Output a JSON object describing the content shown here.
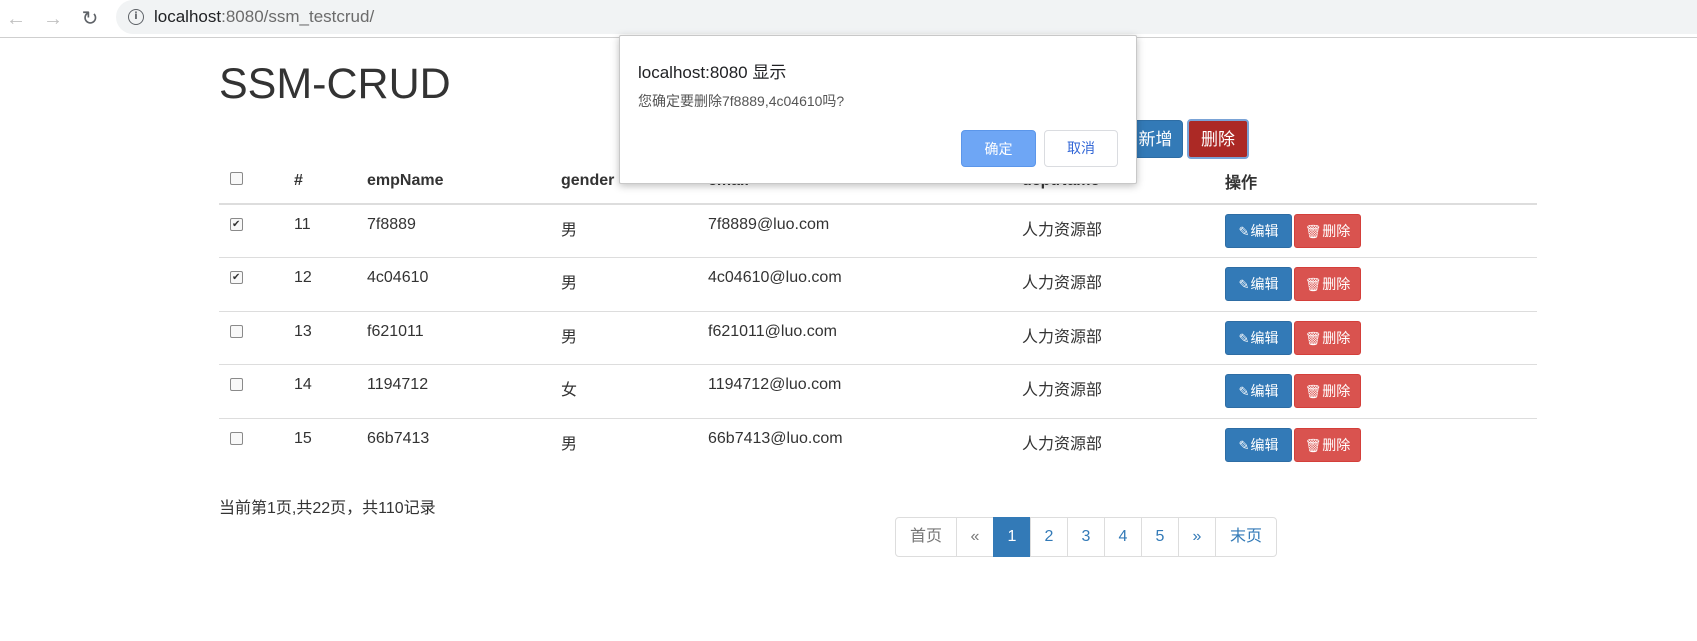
{
  "browser": {
    "url_host": "localhost",
    "url_rest": ":8080/ssm_testcrud/",
    "back_icon": "arrow-left-icon",
    "forward_icon": "arrow-right-icon",
    "reload_icon": "reload-icon"
  },
  "page": {
    "title": "SSM-CRUD",
    "add_label": "新增",
    "delete_label": "删除"
  },
  "table": {
    "headers": [
      "#",
      "empName",
      "gender",
      "email",
      "deptName",
      "操作"
    ],
    "rows": [
      {
        "checked": true,
        "id": "11",
        "name": "7f8889",
        "gender": "男",
        "email": "7f8889@luo.com",
        "dept": "人力资源部"
      },
      {
        "checked": true,
        "id": "12",
        "name": "4c04610",
        "gender": "男",
        "email": "4c04610@luo.com",
        "dept": "人力资源部"
      },
      {
        "checked": false,
        "id": "13",
        "name": "f621011",
        "gender": "男",
        "email": "f621011@luo.com",
        "dept": "人力资源部"
      },
      {
        "checked": false,
        "id": "14",
        "name": "1194712",
        "gender": "女",
        "email": "1194712@luo.com",
        "dept": "人力资源部"
      },
      {
        "checked": false,
        "id": "15",
        "name": "66b7413",
        "gender": "男",
        "email": "66b7413@luo.com",
        "dept": "人力资源部"
      }
    ],
    "edit_label": "编辑",
    "row_delete_label": "删除"
  },
  "footer": {
    "page_info": "当前第1页,共22页，共110记录"
  },
  "pagination": {
    "first": "首页",
    "prev": "«",
    "pages": [
      "1",
      "2",
      "3",
      "4",
      "5"
    ],
    "active_page": "1",
    "next": "»",
    "last": "末页"
  },
  "dialog": {
    "title": "localhost:8080 显示",
    "message": "您确定要删除7f8889,4c04610吗?",
    "ok": "确定",
    "cancel": "取消"
  },
  "colors": {
    "primary": "#337ab7",
    "danger": "#d9534f",
    "danger_active": "#ac2925",
    "dialog_ok": "#6ea6f5"
  }
}
